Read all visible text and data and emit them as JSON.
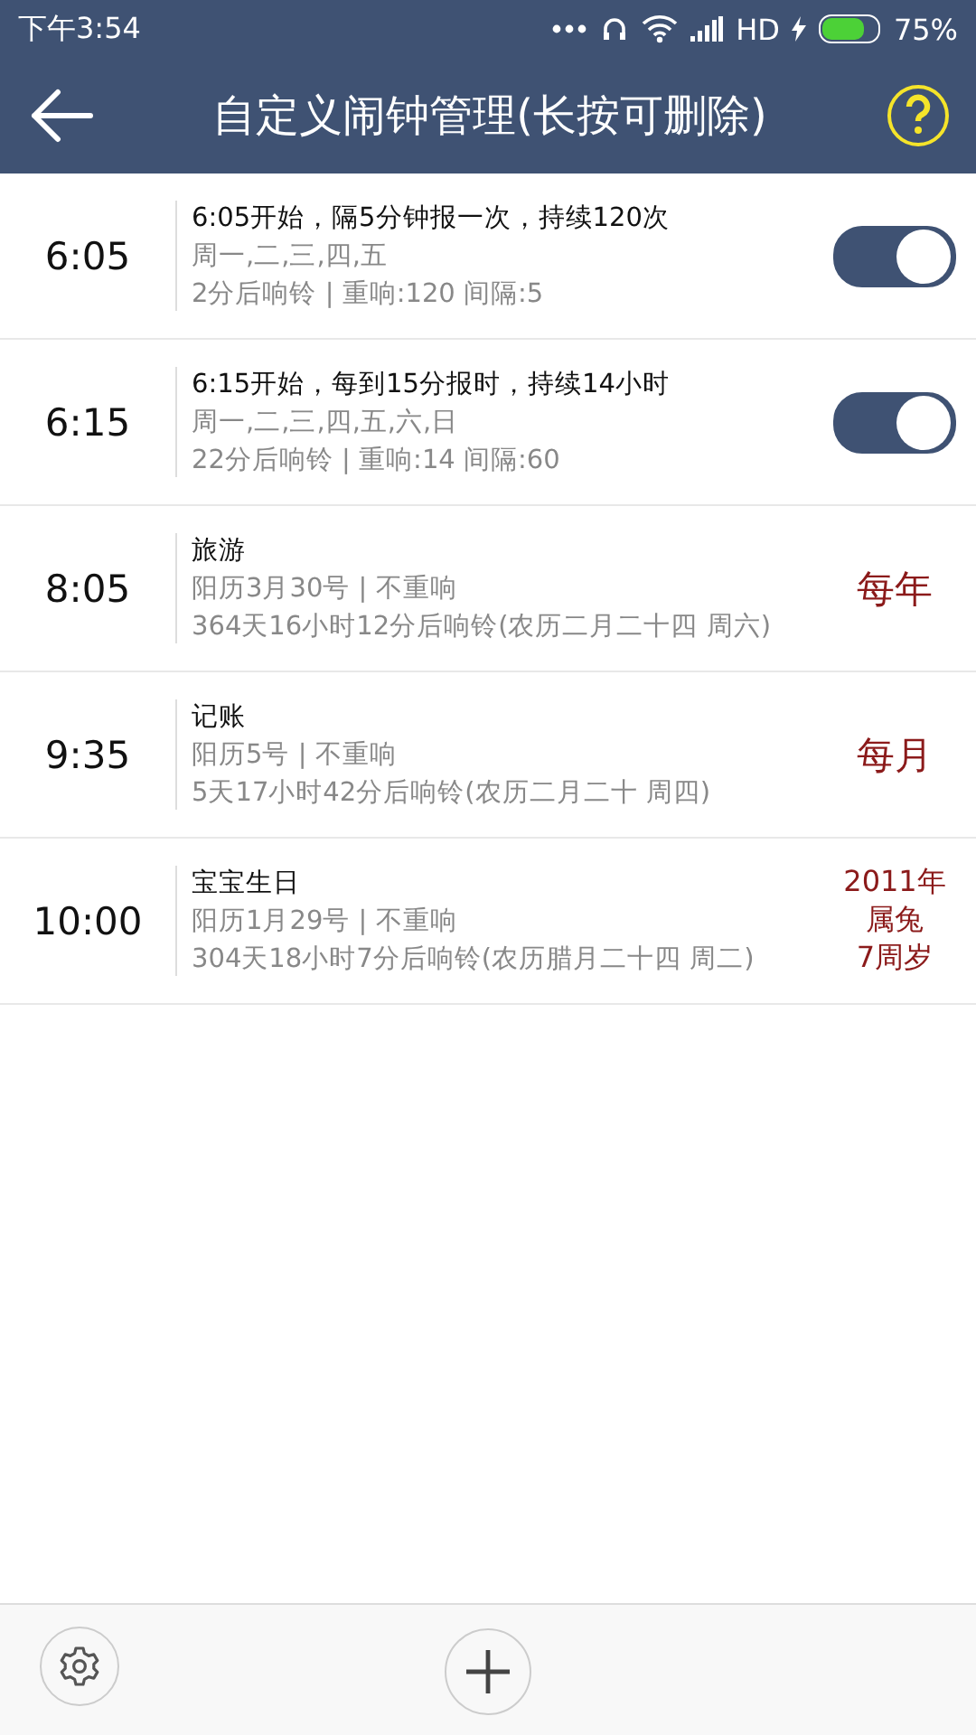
{
  "status_bar": {
    "time": "下午3:54",
    "network": "HD",
    "battery": "75%"
  },
  "header": {
    "title": "自定义闹钟管理(长按可删除)"
  },
  "alarms": [
    {
      "kind": "toggle",
      "time": "6:05",
      "title": "6:05开始，隔5分钟报一次，持续120次",
      "lines": [
        "周一,二,三,四,五",
        "2分后响铃 | 重响:120  间隔:5"
      ],
      "on": true
    },
    {
      "kind": "toggle",
      "time": "6:15",
      "title": "6:15开始，每到15分报时，持续14小时",
      "lines": [
        "周一,二,三,四,五,六,日",
        "22分后响铃 | 重响:14  间隔:60"
      ],
      "on": true
    },
    {
      "kind": "repeat",
      "time": "8:05",
      "title": "旅游",
      "lines": [
        "阳历3月30号 | 不重响",
        "364天16小时12分后响铃(农历二月二十四 周六)"
      ],
      "badge": [
        "每年"
      ]
    },
    {
      "kind": "repeat",
      "time": "9:35",
      "title": "记账",
      "lines": [
        "阳历5号 | 不重响",
        "5天17小时42分后响铃(农历二月二十 周四)"
      ],
      "badge": [
        "每月"
      ]
    },
    {
      "kind": "repeat",
      "time": "10:00",
      "title": "宝宝生日",
      "lines": [
        "阳历1月29号 | 不重响",
        "304天18小时7分后响铃(农历腊月二十四 周二)"
      ],
      "badge": [
        "2011年",
        "属兔",
        "7周岁"
      ]
    }
  ]
}
